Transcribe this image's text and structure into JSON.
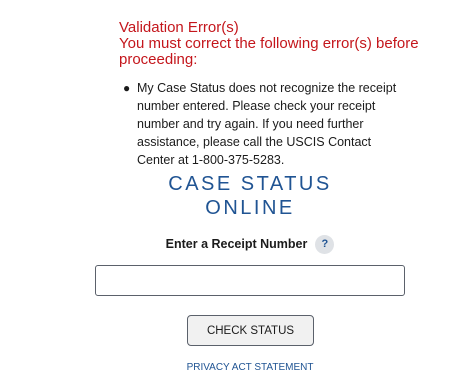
{
  "error": {
    "title": "Validation Error(s)",
    "message_line1": "You must correct the following error(s) before",
    "message_line2": "proceeding:",
    "items": [
      "My Case Status does not recognize the receipt number entered. Please check your receipt number and try again. If you need further assistance, please call the USCIS Contact Center at 1-800-375-5283."
    ]
  },
  "header": {
    "line1": "CASE STATUS",
    "line2": "ONLINE"
  },
  "receipt": {
    "label": "Enter a Receipt Number",
    "help_icon": "?",
    "value": ""
  },
  "actions": {
    "check_status_label": "CHECK STATUS",
    "privacy_label": "PRIVACY ACT STATEMENT"
  },
  "colors": {
    "error": "#c4161c",
    "brand_blue": "#205493",
    "text": "#1b1b1b"
  }
}
